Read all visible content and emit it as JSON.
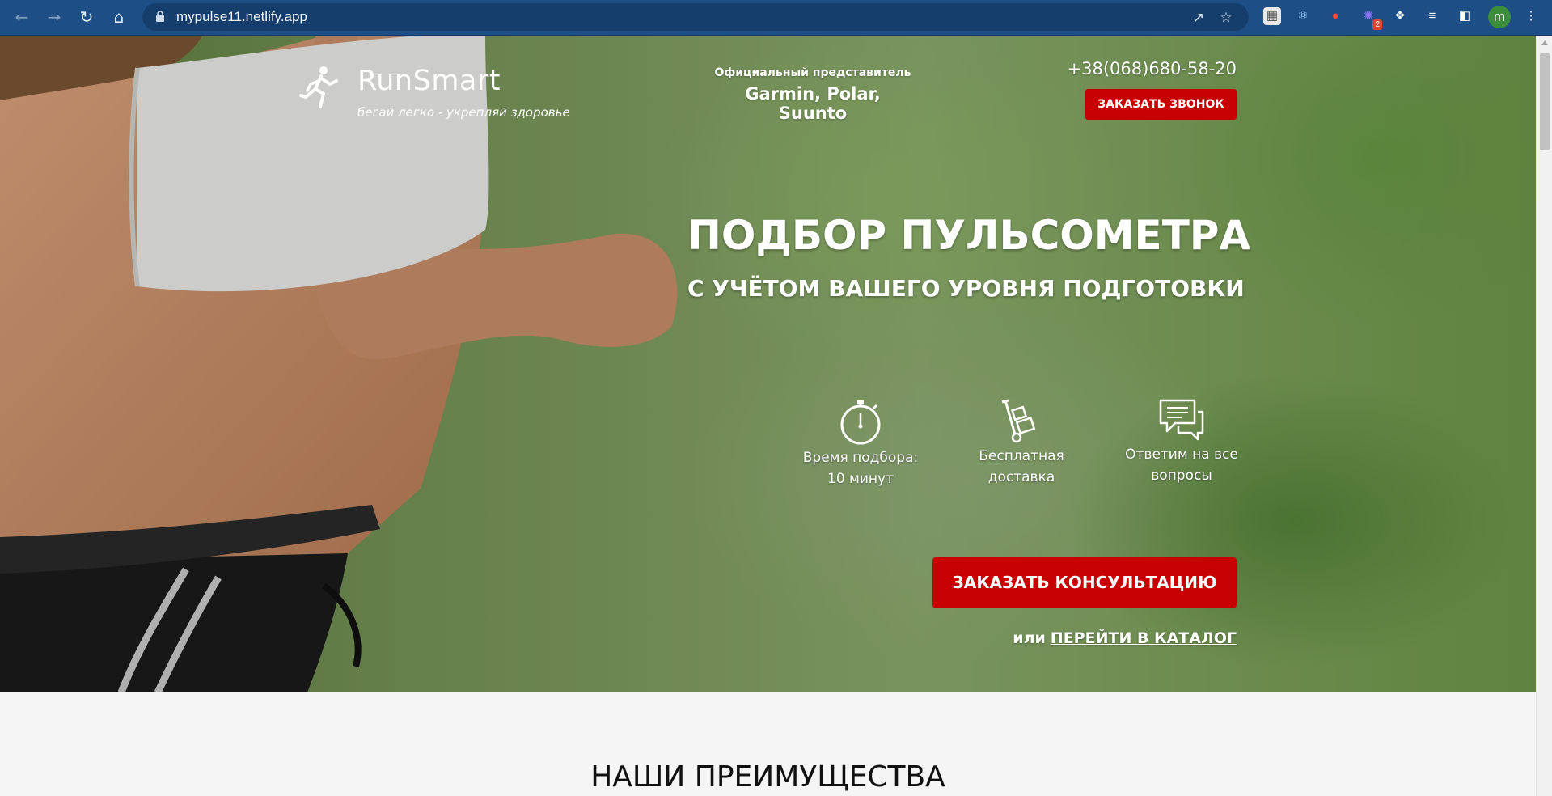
{
  "browser": {
    "url": "mypulse11.netlify.app",
    "profile_initial": "m",
    "extension_badge": "2"
  },
  "header": {
    "logo_title": "RunSmart",
    "logo_subtitle": "бегай легко - укрепляй здоровье",
    "rep_label": "Официальный представитель",
    "rep_brands": "Garmin, Polar, Suunto",
    "phone": "+38(068)680-58-20",
    "call_button": "ЗАКАЗАТЬ ЗВОНОК"
  },
  "hero": {
    "title": "ПОДБОР ПУЛЬСОМЕТРА",
    "subtitle": "С УЧЁТОМ ВАШЕГО УРОВНЯ ПОДГОТОВКИ",
    "features": [
      {
        "icon": "stopwatch-icon",
        "line1": "Время подбора:",
        "line2": "10 минут"
      },
      {
        "icon": "delivery-cart-icon",
        "line1": "Бесплатная",
        "line2": "доставка"
      },
      {
        "icon": "chat-bubbles-icon",
        "line1": "Ответим на все",
        "line2": "вопросы"
      }
    ],
    "consult_button": "ЗАКАЗАТЬ КОНСУЛЬТАЦИЮ",
    "or_text": "или",
    "catalog_link": "ПЕРЕЙТИ В КАТАЛОГ"
  },
  "sections": {
    "advantages_title": "НАШИ ПРЕИМУЩЕСТВА"
  },
  "colors": {
    "accent": "#c70101",
    "browser_toolbar": "#1d4f86"
  }
}
